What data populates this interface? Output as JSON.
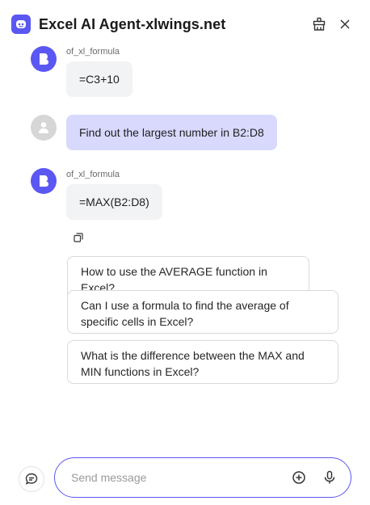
{
  "header": {
    "title": "Excel AI Agent-xlwings.net",
    "logo_icon": "robot-face-icon",
    "clear_icon": "broom-icon",
    "close_icon": "close-icon"
  },
  "messages": [
    {
      "role": "bot",
      "sender": "of_xl_formula",
      "text": "=C3+10"
    },
    {
      "role": "user",
      "text": "Find out the largest number in B2:D8"
    },
    {
      "role": "bot",
      "sender": "of_xl_formula",
      "text": "=MAX(B2:D8)"
    }
  ],
  "copy_icon": "copy-icon",
  "suggestions": [
    "How to use the AVERAGE function in Excel?",
    "Can I use a formula to find the average of specific cells in Excel?",
    "What is the difference between the MAX and MIN functions in Excel?"
  ],
  "composer": {
    "placeholder": "Send message",
    "new_chat_icon": "chat-bubble-plus-icon",
    "add_icon": "plus-circle-icon",
    "mic_icon": "microphone-icon"
  },
  "colors": {
    "accent": "#5b57f2",
    "user_bubble": "#d8d9fd",
    "bot_bubble": "#f2f3f5"
  }
}
